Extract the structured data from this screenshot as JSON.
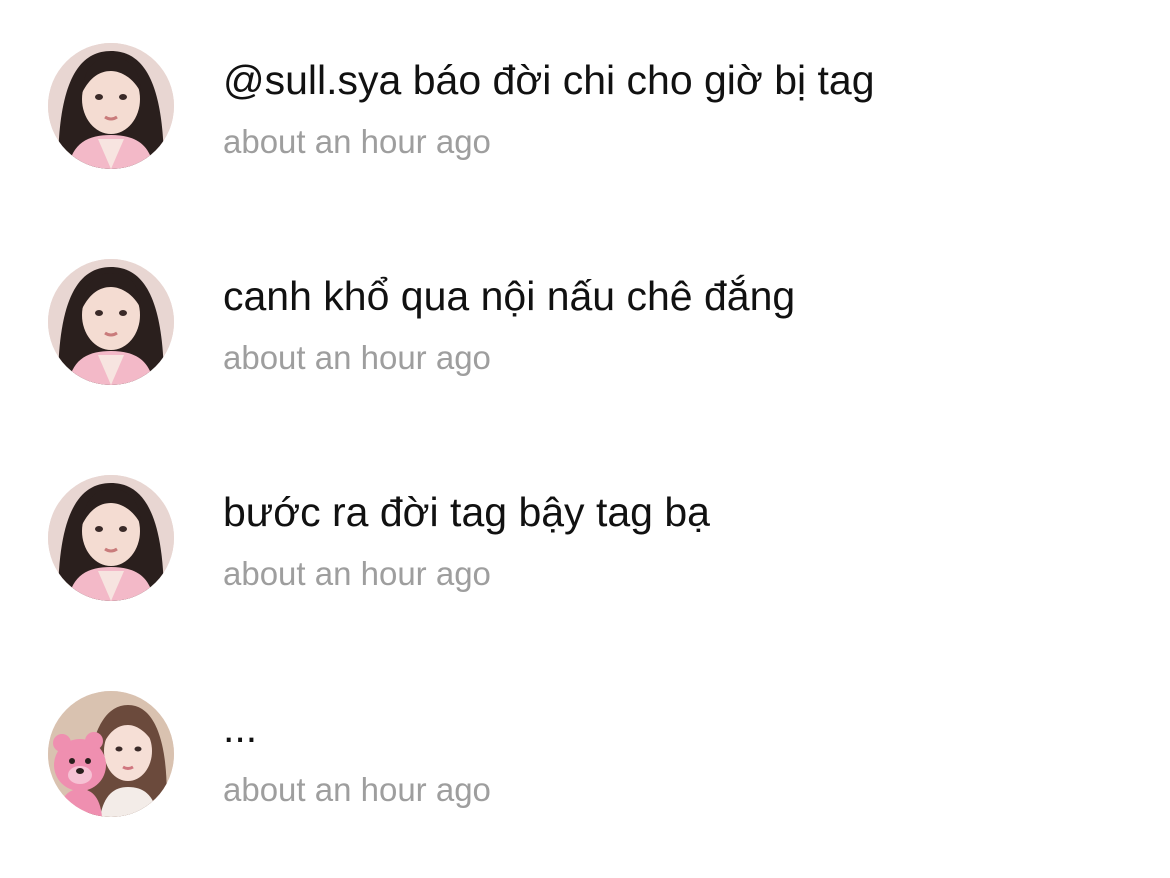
{
  "comments": [
    {
      "text": "@sull.sya báo đời chi cho giờ bị tag",
      "time": "about an hour ago",
      "avatar_icon": "user-avatar-pink-cardigan"
    },
    {
      "text": "canh khổ qua nội nấu chê đắng",
      "time": "about an hour ago",
      "avatar_icon": "user-avatar-pink-cardigan"
    },
    {
      "text": "bước ra đời tag bậy tag bạ",
      "time": "about an hour ago",
      "avatar_icon": "user-avatar-pink-cardigan"
    },
    {
      "text": "...",
      "time": "about an hour ago",
      "avatar_icon": "user-avatar-with-teddy-bear"
    }
  ],
  "colors": {
    "text": "#111111",
    "timestamp": "#9e9e9e",
    "background": "#ffffff"
  }
}
